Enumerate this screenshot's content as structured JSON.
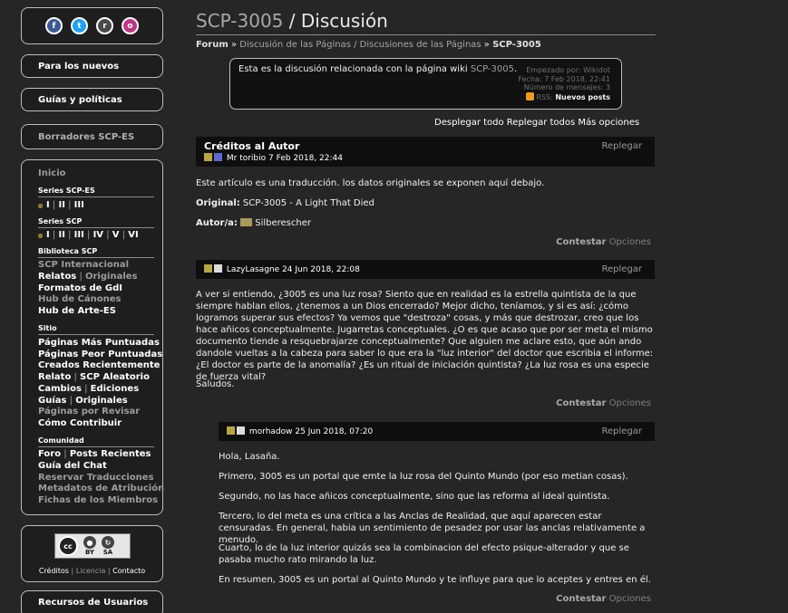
{
  "social": [
    {
      "icon": "facebook-icon",
      "glyph": "f"
    },
    {
      "icon": "twitter-icon",
      "glyph": "t"
    },
    {
      "icon": "reddit-icon",
      "glyph": "r"
    },
    {
      "icon": "instagram-icon",
      "glyph": "o"
    }
  ],
  "nav": {
    "new": "Para los nuevos",
    "guides": "Guías y políticas",
    "drafts": "Borradores SCP-ES"
  },
  "menu": {
    "home": "Inicio",
    "series_es_heading": "Series SCP-ES",
    "series_es": [
      "I",
      "II",
      "III"
    ],
    "series_heading": "Series SCP",
    "series": [
      "I",
      "II",
      "III",
      "IV",
      "V",
      "VI"
    ],
    "library_heading": "Biblioteca SCP",
    "international": "SCP Internacional",
    "tales": "Relatos",
    "originals": "Originales",
    "gdi": "Formatos de GdI",
    "canons": "Hub de Cánones",
    "art": "Hub de Arte-ES",
    "site_heading": "Sitio",
    "top_rated": "Páginas Más Puntuadas",
    "lowest_rated": "Páginas Peor Puntuadas",
    "recent": "Creados Recientemente",
    "random_tale": "Relato",
    "random_scp": "SCP Aleatorio",
    "changes": "Cambios",
    "edits": "Ediciones",
    "guides": "Guías",
    "guides_orig": "Originales",
    "to_review": "Páginas por Revisar",
    "contribute": "Cómo Contribuir",
    "community_heading": "Comunidad",
    "forum": "Foro",
    "recent_posts": "Posts Recientes",
    "chat": "Guía del Chat",
    "reserve": "Reservar Traducciones",
    "attribution": "Metadatos de Atribución",
    "members": "Fichas de los Miembros"
  },
  "license": {
    "cc": "cc",
    "by": "BY",
    "sa": "SA",
    "credits": "Créditos",
    "license": "Licencia",
    "contact": "Contacto"
  },
  "user_resources": "Recursos de Usuarios",
  "page": {
    "title_link": "SCP-3005",
    "title_rest": " / Discusión",
    "crumb_forum": "Forum",
    "crumb_mid": "Discusión de las Páginas / Discusiones de las Páginas",
    "crumb_last": "SCP-3005"
  },
  "info": {
    "text": "Esta es la discusión relacionada con la página wiki ",
    "link": "SCP-3005",
    "started": "Empezado por: Wikidot",
    "date": "Fecha: 7 Feb 2018, 22:41",
    "count": "Número de mensajes: 3",
    "rss": "RSS:",
    "new_posts": "Nuevos posts"
  },
  "actions": "Desplegar todo Replegar todos Más opciones",
  "post1": {
    "title": "Créditos al Autor",
    "author": "Mr toribio",
    "date": "7 Feb 2018, 22:44",
    "fold": "Replegar",
    "line1": "Este artículo es una traducción. los datos originales se exponen aquí debajo.",
    "original_label": "Original:",
    "original_value": " SCP-3005 - A Light That Died",
    "author_label": "Autor/a:",
    "author_value": "Silberescher"
  },
  "post2": {
    "author": "LazyLasagne",
    "date": "24 Jun 2018, 22:08",
    "fold": "Replegar",
    "body": "A ver si entiendo, ¿3005 es una luz rosa? Siento que en realidad es la estrella quintista de la que siempre hablan ellos, ¿tenemos a un Dios encerrado? Mejor dicho, teníamos, y si es así: ¿cómo logramos superar sus efectos? Ya vemos que \"destroza\" cosas, y más que destrozar, creo que los hace añicos conceptualmente. Jugarretas conceptuales. ¿O es que acaso que por ser meta el mismo documento tiende a resquebrajarze conceptualmente? Que alguien me aclare esto, que aún ando dandole vueltas a la cabeza para saber lo que era la \"luz interior\" del doctor que escribia el informe: ¿El doctor es parte de la anomalía? ¿Es un ritual de iniciación quintista? ¿La luz rosa es una especie de fuerza vital?",
    "closing": "Saludos."
  },
  "post3": {
    "author": "morhadow",
    "date": "25 Jun 2018, 07:20",
    "fold": "Replegar",
    "p1": "Hola, Lasaña.",
    "p2": "Primero, 3005 es un portal que emte la luz rosa del Quinto Mundo (por eso metian cosas).",
    "p3": "Segundo, no las hace añicos conceptualmente, sino que las reforma al ideal quintista.",
    "p4": "Tercero, lo del meta es una crítica a las Anclas de Realidad, que aquí aparecen estar censuradas. En general, habia un sentimiento de pesadez por usar las anclas relativamente a menudo.",
    "p5": "Cuarto, lo de la luz interior quizás sea la combinacion del efecto psique-alterador y que se pasaba mucho rato mirando la luz.",
    "p6": "En resumen, 3005 es un portal al Quinto Mundo y te influye para que lo aceptes y entres en él."
  },
  "reply_label": "Contestar",
  "options_label": "Opciones"
}
